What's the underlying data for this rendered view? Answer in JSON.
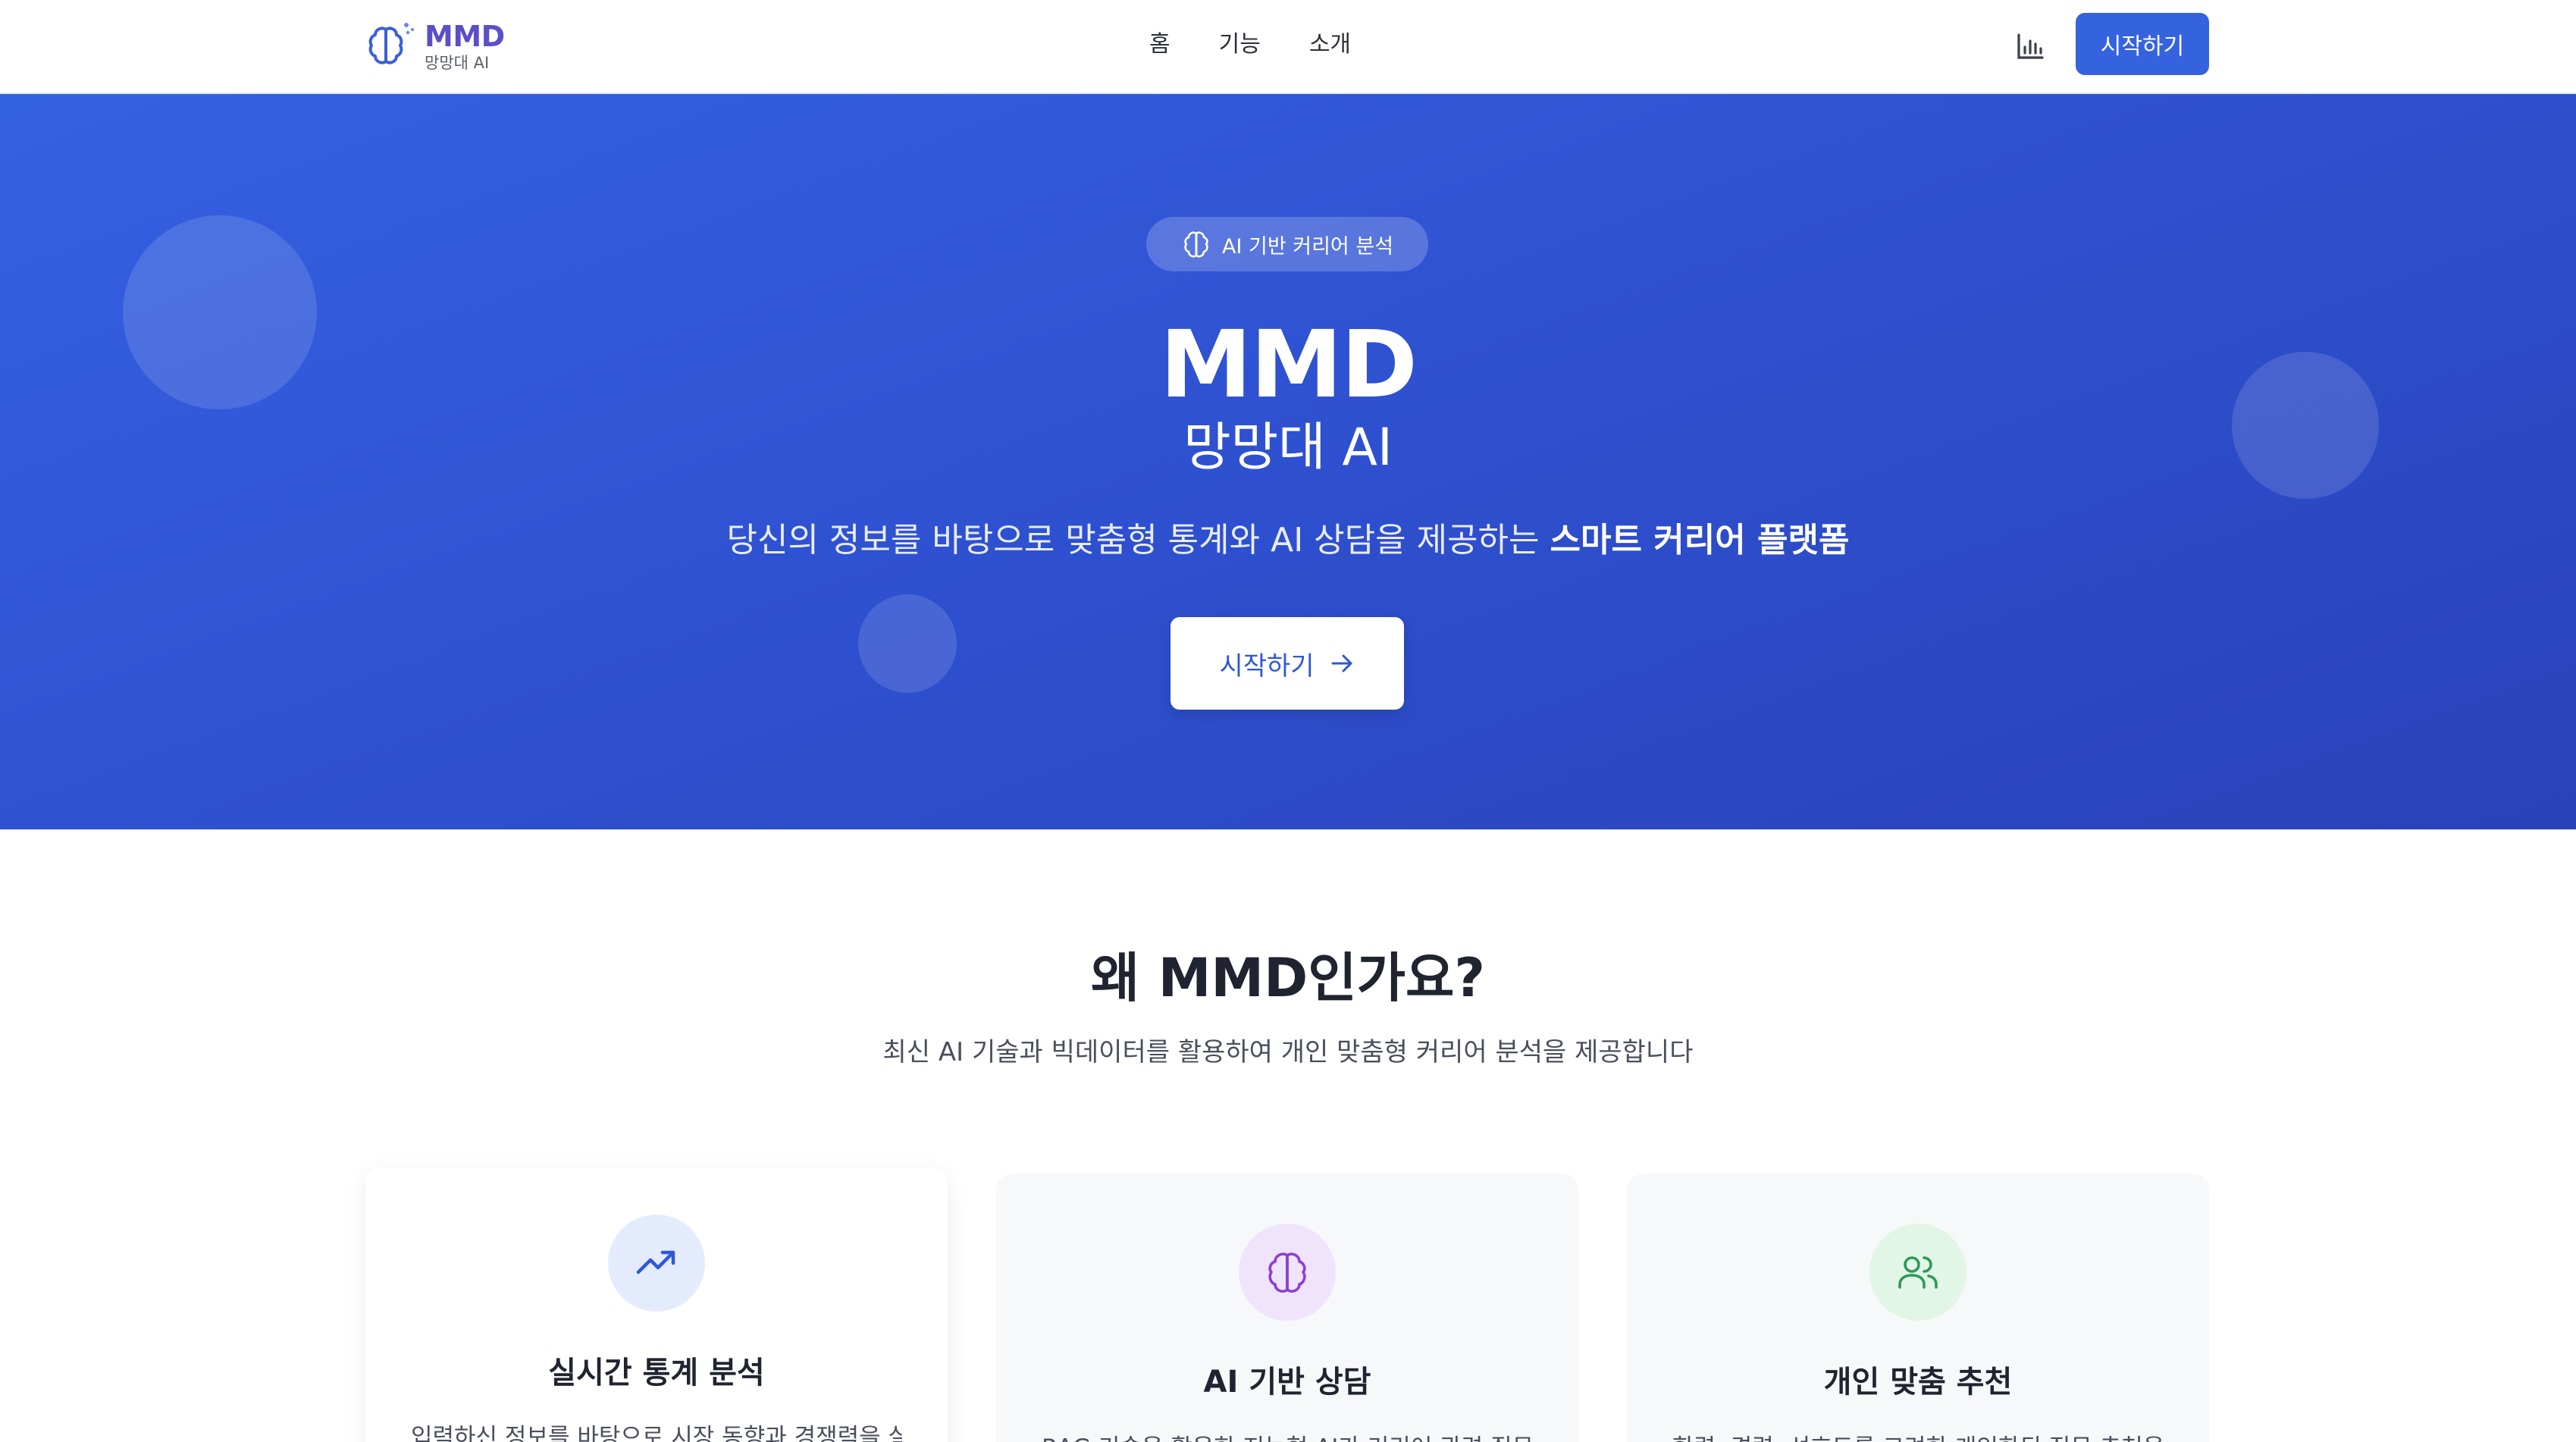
{
  "brand": {
    "title": "MMD",
    "subtitle": "망망대 AI",
    "icon": "brain-sparkle-icon"
  },
  "nav": {
    "links": [
      {
        "label": "홈"
      },
      {
        "label": "기능"
      },
      {
        "label": "소개"
      }
    ],
    "stats_icon": "bar-chart-icon",
    "start_label": "시작하기"
  },
  "hero": {
    "badge_label": "AI 기반 커리어 분석",
    "badge_icon": "brain-icon",
    "title": "MMD",
    "subtitle": "망망대 AI",
    "description_prefix": "당신의 정보를 바탕으로 맞춤형 통계와 AI 상담을 제공하는 ",
    "description_highlight": "스마트 커리어 플랫폼",
    "cta_label": "시작하기",
    "cta_icon": "arrow-right-icon"
  },
  "features": {
    "title": "왜 MMD인가요?",
    "subtitle": "최신 AI 기술과 빅데이터를 활용하여 개인 맞춤형 커리어 분석을 제공합니다",
    "cards": [
      {
        "title": "실시간 통계 분석",
        "icon": "trending-up-icon",
        "description": "입력하신 정보를 바탕으로 시장 동향과 경쟁력을 실"
      },
      {
        "title": "AI 기반 상담",
        "icon": "brain-icon",
        "description": "RAG 기술을 활용한 지능형 AI가 커리어 관련 질문"
      },
      {
        "title": "개인 맞춤 추천",
        "icon": "users-icon",
        "description": "학력, 경력, 선호도를 고려한 개인화된 직무 추천을"
      }
    ]
  },
  "colors": {
    "primary": "#3563e0",
    "brand_text": "#5b4fc8",
    "hero_start": "#3461e2",
    "hero_end": "#2942b8",
    "icon_blue": "#2f58d8",
    "icon_purple": "#8b3fd6",
    "icon_green": "#2e9a55"
  }
}
